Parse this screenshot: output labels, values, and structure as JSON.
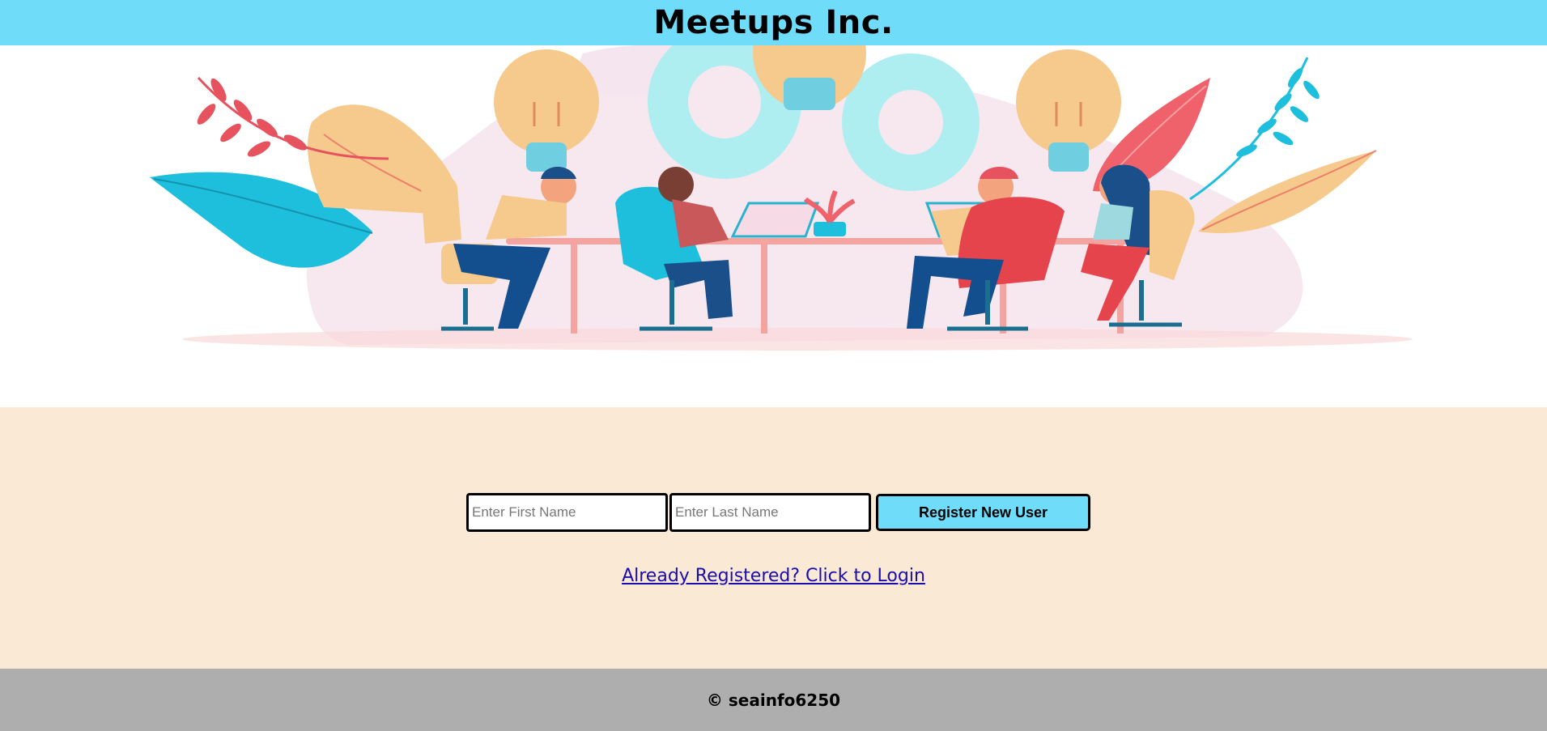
{
  "header": {
    "title": "Meetups Inc."
  },
  "hero": {
    "illustration": "team-meeting-illustration"
  },
  "form": {
    "first_name": {
      "value": "",
      "placeholder": "Enter First Name"
    },
    "last_name": {
      "value": "",
      "placeholder": "Enter Last Name"
    },
    "register_label": "Register New User",
    "login_link_label": "Already Registered? Click to Login"
  },
  "footer": {
    "text": "© seainfo6250"
  },
  "colors": {
    "header_bg": "#6fdcfa",
    "form_bg": "#f9e9d5",
    "footer_bg": "#aeaeae",
    "link": "#1a0dab"
  }
}
